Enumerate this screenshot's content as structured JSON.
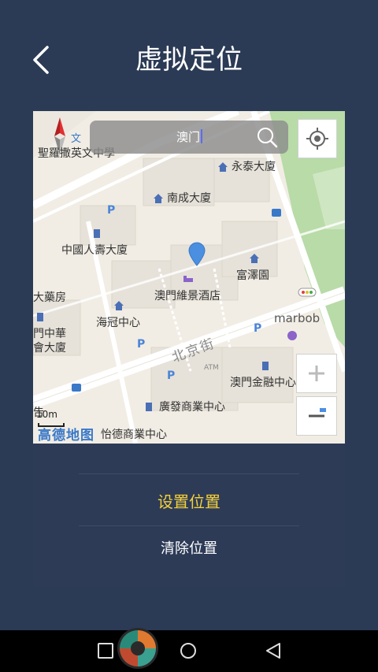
{
  "header": {
    "title": "虚拟定位",
    "back_icon": "chevron-left-icon"
  },
  "map": {
    "search_value": "澳门",
    "labels": {
      "school": "聖羅撒英文中學",
      "wing_tai": "永泰大廈",
      "nam_sing": "南成大廈",
      "china_life": "中國人壽大廈",
      "fu_chak": "富澤園",
      "pharmacy": "大藥房",
      "hotel": "澳門維景酒店",
      "hoi_kun": "海冠中心",
      "marbob": "marbob",
      "zhonghua_1": "門中華",
      "zhonghua_2": "會大廈",
      "financial": "澳門金融中心",
      "tak_fat": "廣發商業中心",
      "yi_tak": "怡德商業中心",
      "atm": "ATM",
      "wen": "文",
      "street": "北京街",
      "edge_char": "告"
    },
    "scale": "10m",
    "logo": "高德地图",
    "colors": {
      "pin": "#4a8fe0",
      "park": "#b8dba8",
      "road": "#ffffff"
    }
  },
  "panel": {
    "set_label": "设置位置",
    "clear_label": "清除位置",
    "colors": {
      "set": "#f5d13a",
      "clear": "#ffffff"
    }
  },
  "navbar": {
    "icons": [
      "square-icon",
      "circle-icon",
      "triangle-back-icon"
    ]
  }
}
